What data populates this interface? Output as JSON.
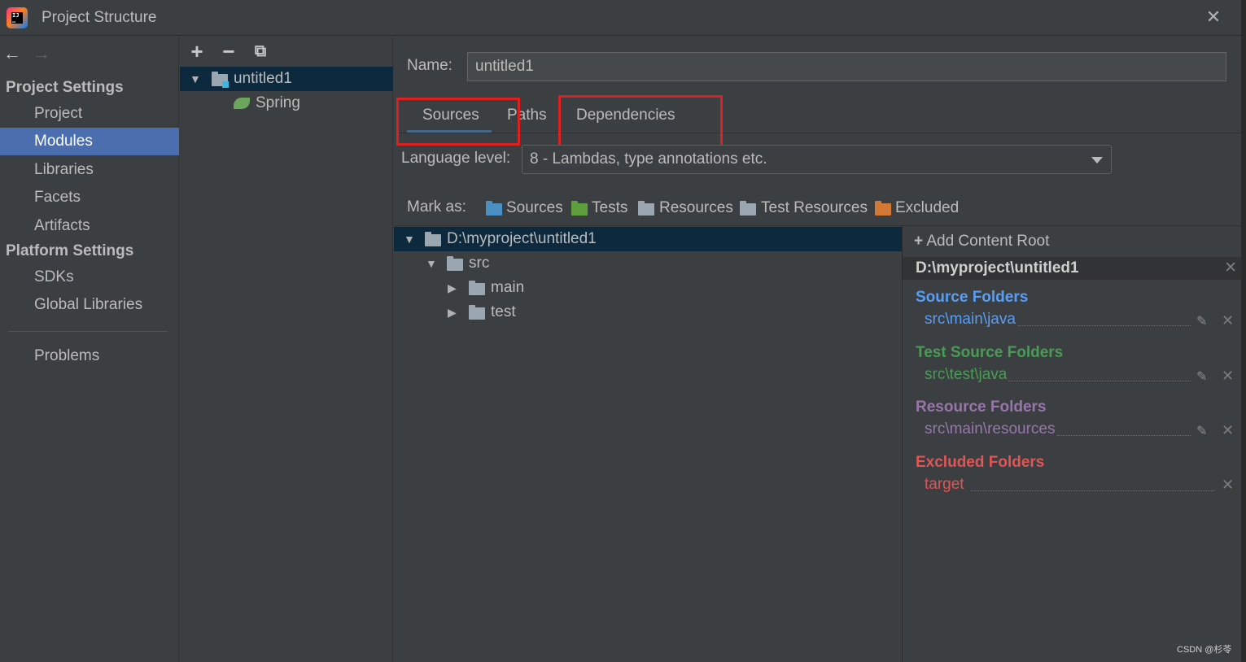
{
  "window": {
    "title": "Project Structure"
  },
  "left_nav": {
    "project_settings_header": "Project Settings",
    "project_items": [
      "Project",
      "Modules",
      "Libraries",
      "Facets",
      "Artifacts"
    ],
    "platform_settings_header": "Platform Settings",
    "platform_items": [
      "SDKs",
      "Global Libraries"
    ],
    "problems": "Problems",
    "selected": "Modules"
  },
  "module_tree": {
    "module_name": "untitled1",
    "facet": "Spring"
  },
  "module_editor": {
    "name_label": "Name:",
    "name_value": "untitled1",
    "tabs": [
      "Sources",
      "Paths",
      "Dependencies"
    ],
    "active_tab": "Sources",
    "language_level_label": "Language level:",
    "language_level_value": "8 - Lambdas, type annotations etc.",
    "mark_as_label": "Mark as:",
    "mark_as_options": [
      {
        "label": "Sources",
        "color": "#4a90c2"
      },
      {
        "label": "Tests",
        "color": "#5f9e3e"
      },
      {
        "label": "Resources",
        "color": "#9aa7b0"
      },
      {
        "label": "Test Resources",
        "color": "#9aa7b0"
      },
      {
        "label": "Excluded",
        "color": "#d27a35"
      }
    ]
  },
  "content_tree": {
    "root": "D:\\myproject\\untitled1",
    "src": "src",
    "main": "main",
    "test": "test"
  },
  "content_roots": {
    "add_label": "Add Content Root",
    "root_path": "D:\\myproject\\untitled1",
    "source_folders_title": "Source Folders",
    "source_folder": "src\\main\\java",
    "test_source_folders_title": "Test Source Folders",
    "test_source_folder": "src\\test\\java",
    "resource_folders_title": "Resource Folders",
    "resource_folder": "src\\main\\resources",
    "excluded_folders_title": "Excluded Folders",
    "excluded_folder": "target"
  },
  "colors": {
    "source": "#589df6",
    "test": "#499c54",
    "resource": "#9876aa",
    "excluded": "#e05555",
    "selection": "#4b6eaf",
    "annotation_box": "#e02020"
  },
  "watermark": "CSDN @杉苓"
}
